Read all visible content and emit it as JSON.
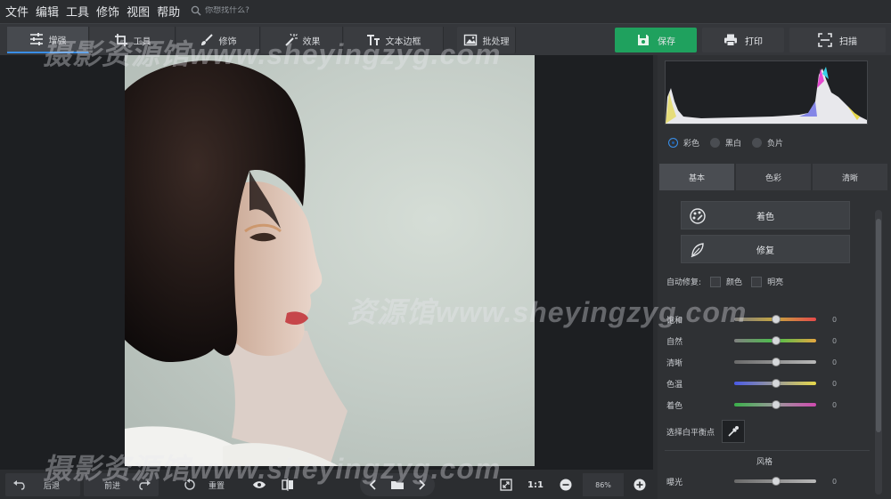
{
  "menu": [
    "文件",
    "编辑",
    "工具",
    "修饰",
    "视图",
    "帮助"
  ],
  "search": {
    "placeholder": "你想找什么?",
    "icon": "search-icon"
  },
  "toolbar": {
    "tabs": [
      {
        "label": "增强",
        "icon": "sliders-icon",
        "active": true
      },
      {
        "label": "工具",
        "icon": "crop-icon"
      },
      {
        "label": "修饰",
        "icon": "brush-icon"
      },
      {
        "label": "效果",
        "icon": "magic-wand-icon"
      },
      {
        "label": "文本边框",
        "icon": "text-icon"
      },
      {
        "label": "批处理",
        "icon": "batch-image-icon"
      }
    ],
    "save_label": "保存",
    "print_label": "打印",
    "scan_label": "扫描"
  },
  "panel": {
    "modes": [
      "彩色",
      "黑白",
      "负片"
    ],
    "selected_mode": "彩色",
    "subtabs": [
      "基本",
      "色彩",
      "清晰"
    ],
    "active_subtab": "基本",
    "colorize_label": "着色",
    "repair_label": "修复",
    "autofix": {
      "label": "自动修复:",
      "options": [
        "颜色",
        "明亮"
      ]
    },
    "sliders": [
      {
        "label": "饱和",
        "value": "0"
      },
      {
        "label": "自然",
        "value": "0"
      },
      {
        "label": "清晰",
        "value": "0"
      },
      {
        "label": "色温",
        "value": "0"
      },
      {
        "label": "着色",
        "value": "0"
      }
    ],
    "white_balance_label": "选择白平衡点",
    "style_section": "风格",
    "exposure": {
      "label": "曝光",
      "value": "0"
    }
  },
  "bottom": {
    "undo_label": "后退",
    "redo_label": "前进",
    "reset_label": "重置",
    "ratio_label": "1:1",
    "zoom_value": "86%"
  },
  "watermark": {
    "text_top": "摄影资源馆www.sheyingzyg.com",
    "text_mid": "资源馆www.sheyingzyg.com",
    "text_bottom": "摄影资源馆www.sheyingzyg.com"
  },
  "colors": {
    "accent": "#3a8ee6",
    "save": "#1fa15e",
    "background": "#2b2d30",
    "canvas": "#1d1f22"
  }
}
